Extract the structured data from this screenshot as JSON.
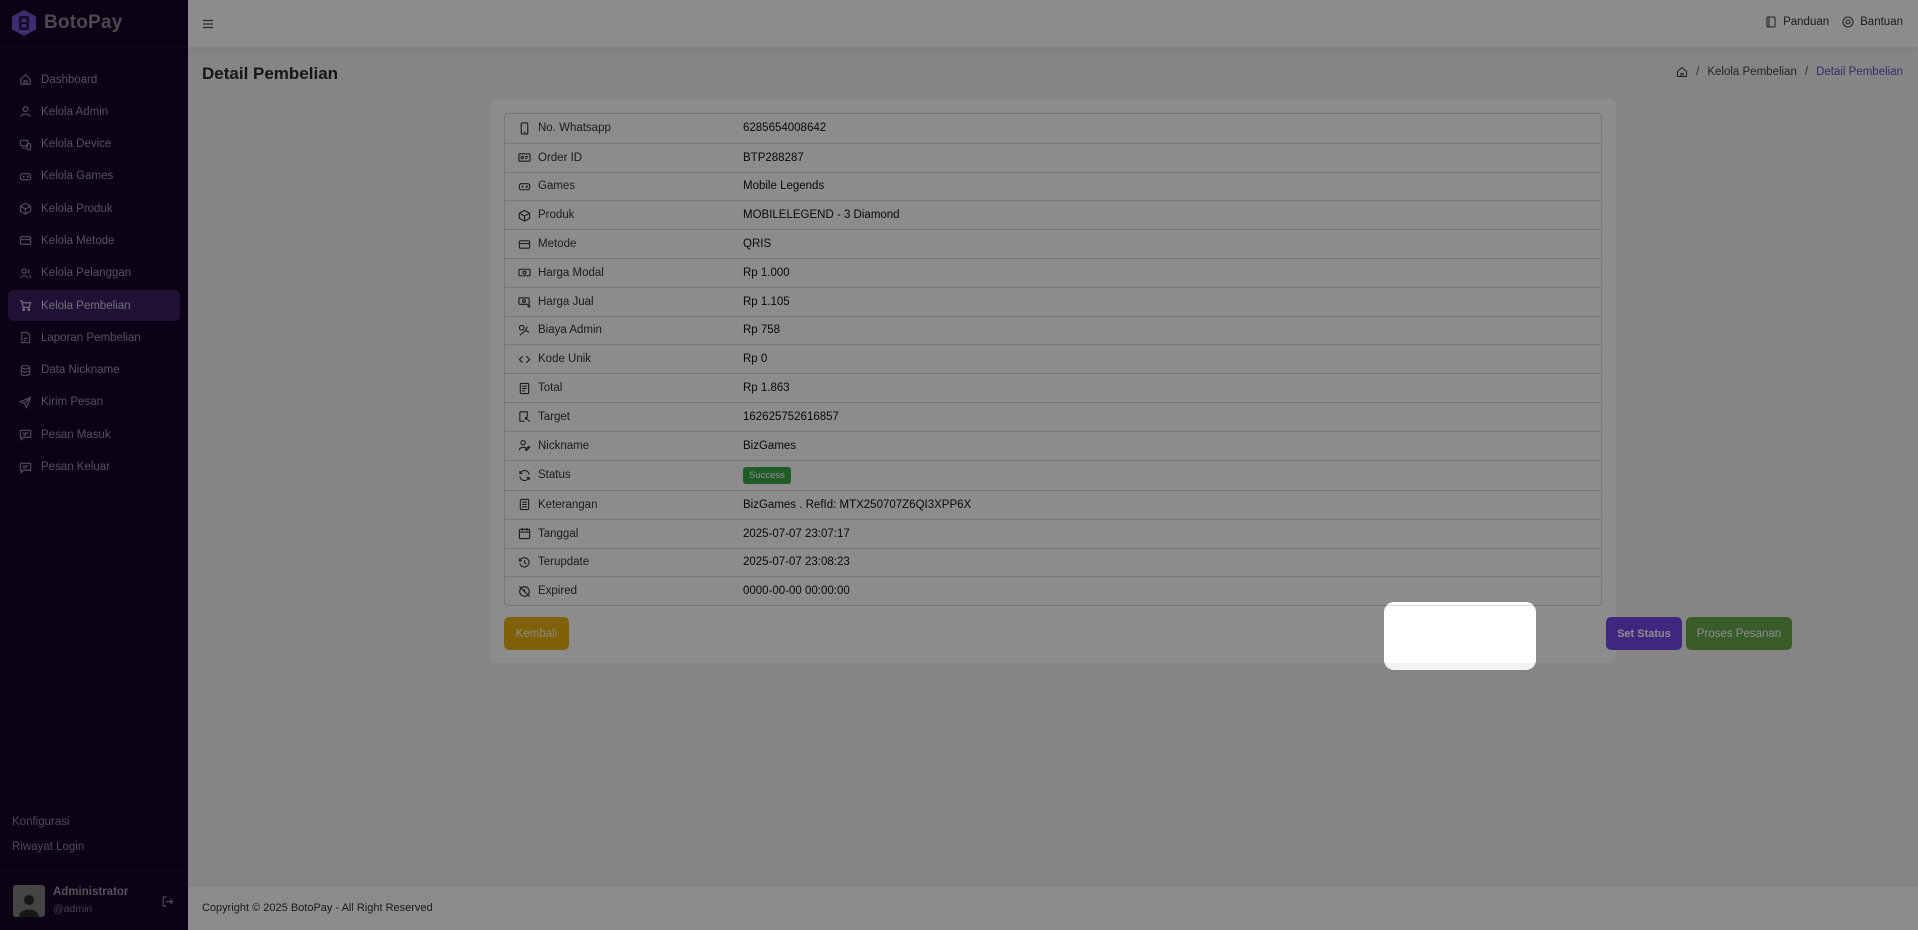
{
  "app": {
    "brand": "BotoPay"
  },
  "sidebar": {
    "items": [
      {
        "label": "Dashboard",
        "icon": "home-icon"
      },
      {
        "label": "Kelola Admin",
        "icon": "user-icon"
      },
      {
        "label": "Kelola Device",
        "icon": "devices-icon"
      },
      {
        "label": "Kelola Games",
        "icon": "gamepad-icon"
      },
      {
        "label": "Kelola Produk",
        "icon": "box-icon"
      },
      {
        "label": "Kelola Metode",
        "icon": "credit-card-icon"
      },
      {
        "label": "Kelola Pelanggan",
        "icon": "users-icon"
      },
      {
        "label": "Kelola Pembelian",
        "icon": "cart-icon",
        "active": true
      },
      {
        "label": "Laporan Pembelian",
        "icon": "report-icon"
      },
      {
        "label": "Data Nickname",
        "icon": "database-icon"
      },
      {
        "label": "Kirim Pesan",
        "icon": "send-icon"
      },
      {
        "label": "Pesan Masuk",
        "icon": "inbox-icon"
      },
      {
        "label": "Pesan Keluar",
        "icon": "outbox-icon"
      }
    ],
    "bottom_links": [
      "Konfigurasi",
      "Riwayat Login"
    ],
    "user": {
      "name": "Administrator",
      "handle": "@admin"
    }
  },
  "topbar": {
    "guide": "Panduan",
    "help": "Bantuan"
  },
  "page": {
    "title": "Detail Pembelian",
    "breadcrumb": [
      "Kelola Pembelian",
      "Detail Pembelian"
    ]
  },
  "details": [
    {
      "label": "No. Whatsapp",
      "value": "6285654008642",
      "icon": "phone-icon"
    },
    {
      "label": "Order ID",
      "value": "BTP288287",
      "icon": "id-card-icon"
    },
    {
      "label": "Games",
      "value": "Mobile Legends",
      "icon": "gamepad-icon"
    },
    {
      "label": "Produk",
      "value": "MOBILELEGEND - 3 Diamond",
      "icon": "box-icon"
    },
    {
      "label": "Metode",
      "value": "QRIS",
      "icon": "credit-card-icon"
    },
    {
      "label": "Harga Modal",
      "value": "Rp 1.000",
      "icon": "cash-icon"
    },
    {
      "label": "Harga Jual",
      "value": "Rp 1.105",
      "icon": "cash-out-icon"
    },
    {
      "label": "Biaya Admin",
      "value": "Rp 758",
      "icon": "fee-icon"
    },
    {
      "label": "Kode Unik",
      "value": "Rp 0",
      "icon": "code-icon"
    },
    {
      "label": "Total",
      "value": "Rp 1.863",
      "icon": "receipt-icon"
    },
    {
      "label": "Target",
      "value": "162625752616857",
      "icon": "target-icon"
    },
    {
      "label": "Nickname",
      "value": "BizGames",
      "icon": "user-edit-icon"
    },
    {
      "label": "Status",
      "value": "Success",
      "icon": "refresh-icon",
      "badge": true,
      "badge_color": "#3aa84a"
    },
    {
      "label": "Keterangan",
      "value": "BizGames . RefId: MTX250707Z6QI3XPP6X",
      "icon": "note-icon"
    },
    {
      "label": "Tanggal",
      "value": "2025-07-07 23:07:17",
      "icon": "calendar-icon"
    },
    {
      "label": "Terupdate",
      "value": "2025-07-07 23:08:23",
      "icon": "history-icon"
    },
    {
      "label": "Expired",
      "value": "0000-00-00 00:00:00",
      "icon": "clock-off-icon"
    }
  ],
  "buttons": {
    "back": "Kembali",
    "set_status": "Set Status",
    "process": "Proses Pesanan"
  },
  "colors": {
    "sidebar_bg": "#150627",
    "accent": "#7048e8",
    "warning": "#e6b112",
    "success": "#6aa84f"
  },
  "footer": {
    "text": "Copyright © 2025 BotoPay - All Right Reserved"
  }
}
